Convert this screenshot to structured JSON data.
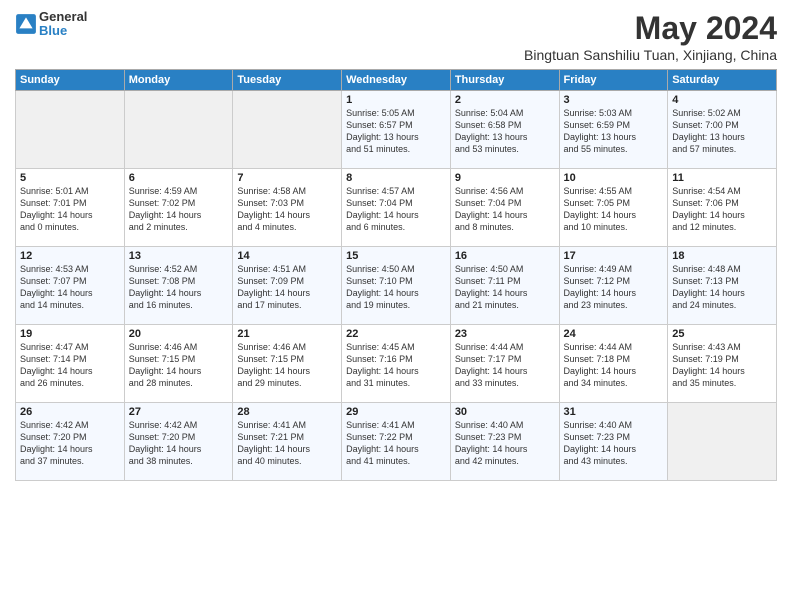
{
  "logo": {
    "general": "General",
    "blue": "Blue"
  },
  "title": {
    "month_year": "May 2024",
    "location": "Bingtuan Sanshiliu Tuan, Xinjiang, China"
  },
  "headers": [
    "Sunday",
    "Monday",
    "Tuesday",
    "Wednesday",
    "Thursday",
    "Friday",
    "Saturday"
  ],
  "weeks": [
    [
      {
        "day": "",
        "info": ""
      },
      {
        "day": "",
        "info": ""
      },
      {
        "day": "",
        "info": ""
      },
      {
        "day": "1",
        "info": "Sunrise: 5:05 AM\nSunset: 6:57 PM\nDaylight: 13 hours\nand 51 minutes."
      },
      {
        "day": "2",
        "info": "Sunrise: 5:04 AM\nSunset: 6:58 PM\nDaylight: 13 hours\nand 53 minutes."
      },
      {
        "day": "3",
        "info": "Sunrise: 5:03 AM\nSunset: 6:59 PM\nDaylight: 13 hours\nand 55 minutes."
      },
      {
        "day": "4",
        "info": "Sunrise: 5:02 AM\nSunset: 7:00 PM\nDaylight: 13 hours\nand 57 minutes."
      }
    ],
    [
      {
        "day": "5",
        "info": "Sunrise: 5:01 AM\nSunset: 7:01 PM\nDaylight: 14 hours\nand 0 minutes."
      },
      {
        "day": "6",
        "info": "Sunrise: 4:59 AM\nSunset: 7:02 PM\nDaylight: 14 hours\nand 2 minutes."
      },
      {
        "day": "7",
        "info": "Sunrise: 4:58 AM\nSunset: 7:03 PM\nDaylight: 14 hours\nand 4 minutes."
      },
      {
        "day": "8",
        "info": "Sunrise: 4:57 AM\nSunset: 7:04 PM\nDaylight: 14 hours\nand 6 minutes."
      },
      {
        "day": "9",
        "info": "Sunrise: 4:56 AM\nSunset: 7:04 PM\nDaylight: 14 hours\nand 8 minutes."
      },
      {
        "day": "10",
        "info": "Sunrise: 4:55 AM\nSunset: 7:05 PM\nDaylight: 14 hours\nand 10 minutes."
      },
      {
        "day": "11",
        "info": "Sunrise: 4:54 AM\nSunset: 7:06 PM\nDaylight: 14 hours\nand 12 minutes."
      }
    ],
    [
      {
        "day": "12",
        "info": "Sunrise: 4:53 AM\nSunset: 7:07 PM\nDaylight: 14 hours\nand 14 minutes."
      },
      {
        "day": "13",
        "info": "Sunrise: 4:52 AM\nSunset: 7:08 PM\nDaylight: 14 hours\nand 16 minutes."
      },
      {
        "day": "14",
        "info": "Sunrise: 4:51 AM\nSunset: 7:09 PM\nDaylight: 14 hours\nand 17 minutes."
      },
      {
        "day": "15",
        "info": "Sunrise: 4:50 AM\nSunset: 7:10 PM\nDaylight: 14 hours\nand 19 minutes."
      },
      {
        "day": "16",
        "info": "Sunrise: 4:50 AM\nSunset: 7:11 PM\nDaylight: 14 hours\nand 21 minutes."
      },
      {
        "day": "17",
        "info": "Sunrise: 4:49 AM\nSunset: 7:12 PM\nDaylight: 14 hours\nand 23 minutes."
      },
      {
        "day": "18",
        "info": "Sunrise: 4:48 AM\nSunset: 7:13 PM\nDaylight: 14 hours\nand 24 minutes."
      }
    ],
    [
      {
        "day": "19",
        "info": "Sunrise: 4:47 AM\nSunset: 7:14 PM\nDaylight: 14 hours\nand 26 minutes."
      },
      {
        "day": "20",
        "info": "Sunrise: 4:46 AM\nSunset: 7:15 PM\nDaylight: 14 hours\nand 28 minutes."
      },
      {
        "day": "21",
        "info": "Sunrise: 4:46 AM\nSunset: 7:15 PM\nDaylight: 14 hours\nand 29 minutes."
      },
      {
        "day": "22",
        "info": "Sunrise: 4:45 AM\nSunset: 7:16 PM\nDaylight: 14 hours\nand 31 minutes."
      },
      {
        "day": "23",
        "info": "Sunrise: 4:44 AM\nSunset: 7:17 PM\nDaylight: 14 hours\nand 33 minutes."
      },
      {
        "day": "24",
        "info": "Sunrise: 4:44 AM\nSunset: 7:18 PM\nDaylight: 14 hours\nand 34 minutes."
      },
      {
        "day": "25",
        "info": "Sunrise: 4:43 AM\nSunset: 7:19 PM\nDaylight: 14 hours\nand 35 minutes."
      }
    ],
    [
      {
        "day": "26",
        "info": "Sunrise: 4:42 AM\nSunset: 7:20 PM\nDaylight: 14 hours\nand 37 minutes."
      },
      {
        "day": "27",
        "info": "Sunrise: 4:42 AM\nSunset: 7:20 PM\nDaylight: 14 hours\nand 38 minutes."
      },
      {
        "day": "28",
        "info": "Sunrise: 4:41 AM\nSunset: 7:21 PM\nDaylight: 14 hours\nand 40 minutes."
      },
      {
        "day": "29",
        "info": "Sunrise: 4:41 AM\nSunset: 7:22 PM\nDaylight: 14 hours\nand 41 minutes."
      },
      {
        "day": "30",
        "info": "Sunrise: 4:40 AM\nSunset: 7:23 PM\nDaylight: 14 hours\nand 42 minutes."
      },
      {
        "day": "31",
        "info": "Sunrise: 4:40 AM\nSunset: 7:23 PM\nDaylight: 14 hours\nand 43 minutes."
      },
      {
        "day": "",
        "info": ""
      }
    ]
  ]
}
